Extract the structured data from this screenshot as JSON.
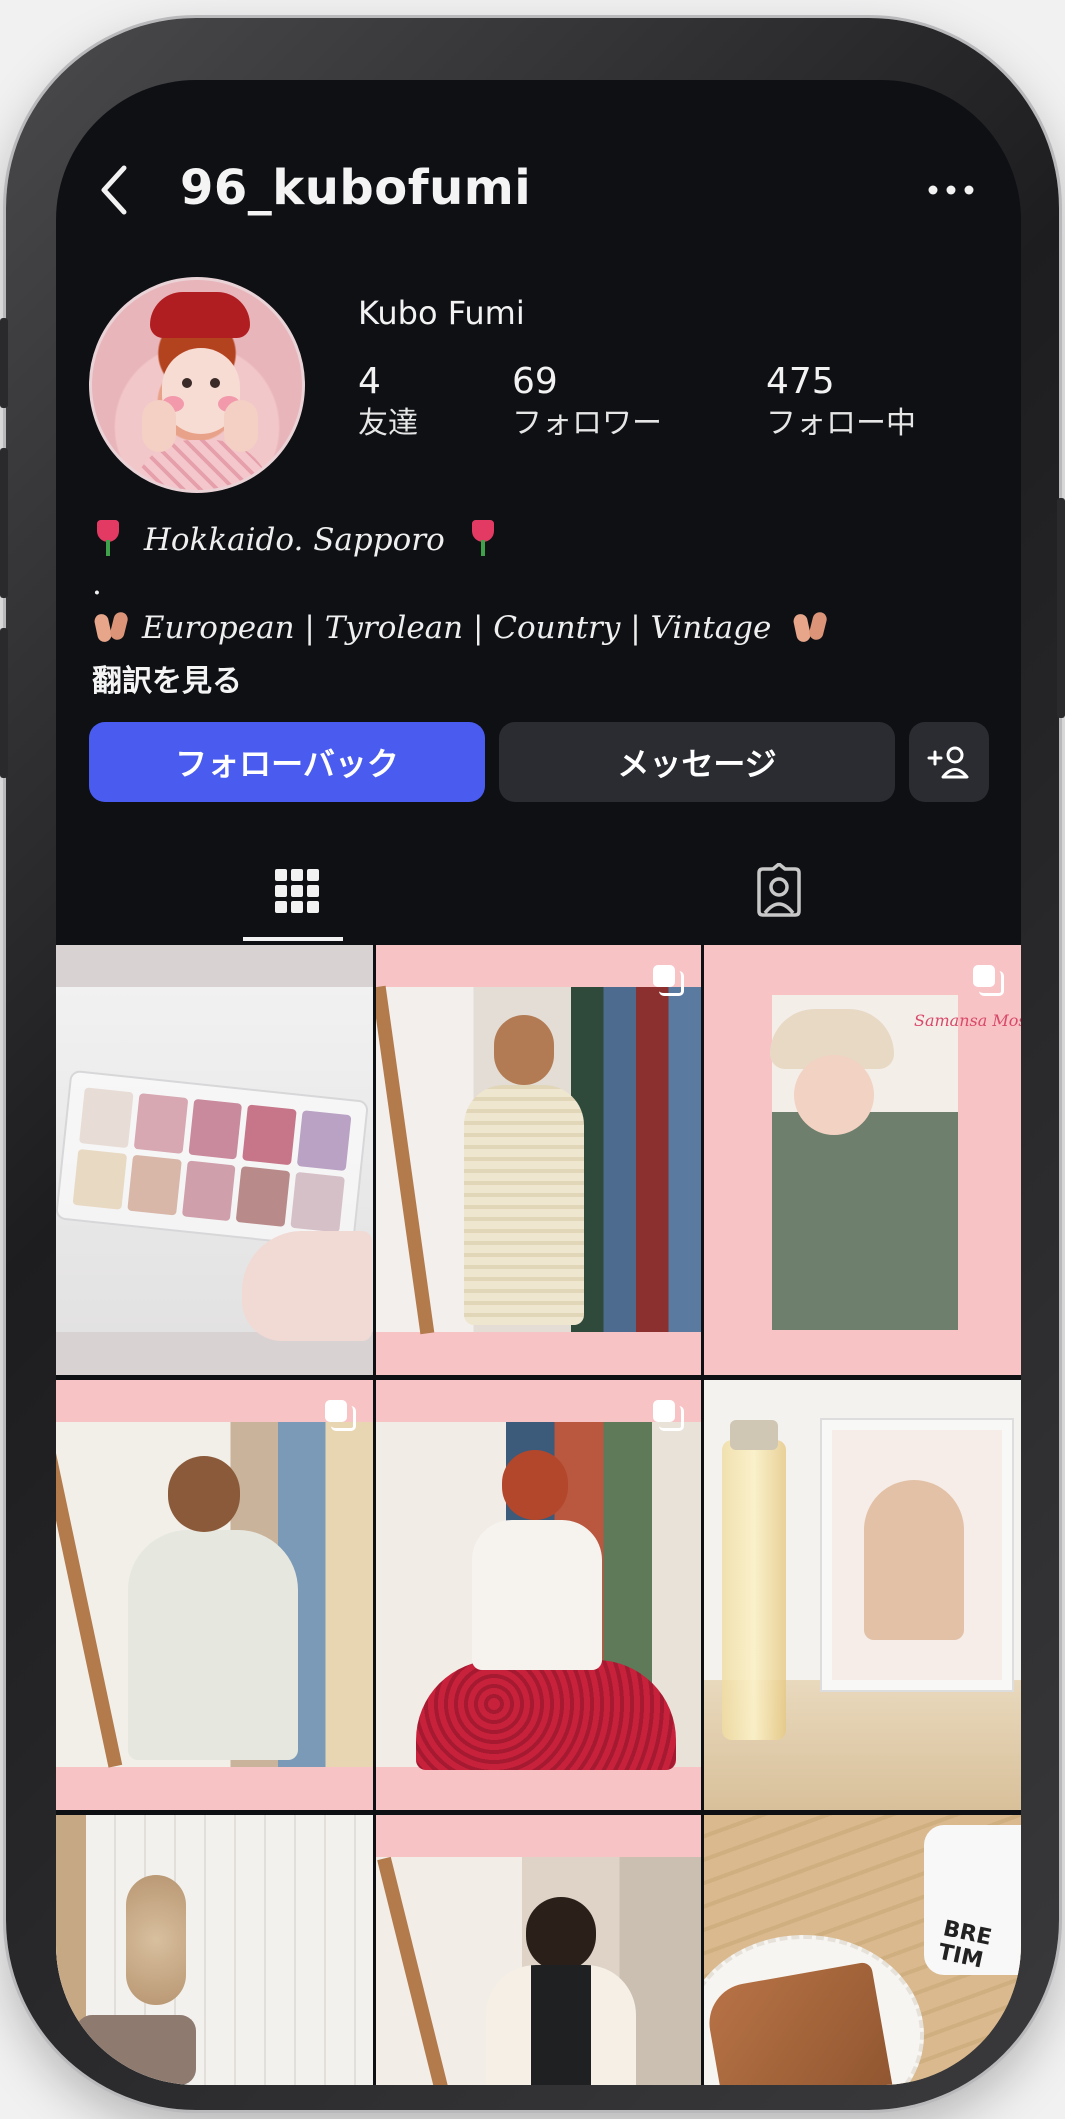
{
  "header": {
    "username": "96_kubofumi"
  },
  "profile": {
    "display_name": "Kubo Fumi",
    "stats": [
      {
        "value": "4",
        "label": "友達"
      },
      {
        "value": "69",
        "label": "フォロワー"
      },
      {
        "value": "475",
        "label": "フォロー中"
      }
    ],
    "bio_line1": "Hokkaido. Sapporo",
    "bio_line2": ".",
    "bio_line3": "European | Tyrolean | Country | Vintage",
    "translate_link": "翻訳を見る"
  },
  "actions": {
    "follow_back": "フォローバック",
    "message": "メッセージ"
  },
  "icons": {
    "back": "chevron-left-icon",
    "more": "ellipsis-icon",
    "add_user": "add-person-icon",
    "grid": "grid-icon",
    "tagged": "tagged-person-icon",
    "multi": "carousel-icon"
  },
  "colors": {
    "background": "#0e1014",
    "follow_button": "#4a5cf0",
    "secondary_button": "#2a2c32",
    "tile_pink": "#f7c3c5"
  },
  "grid": {
    "post3_overlay_text": "Samansa Mos",
    "post9_cup_text": "BRE TIM"
  }
}
